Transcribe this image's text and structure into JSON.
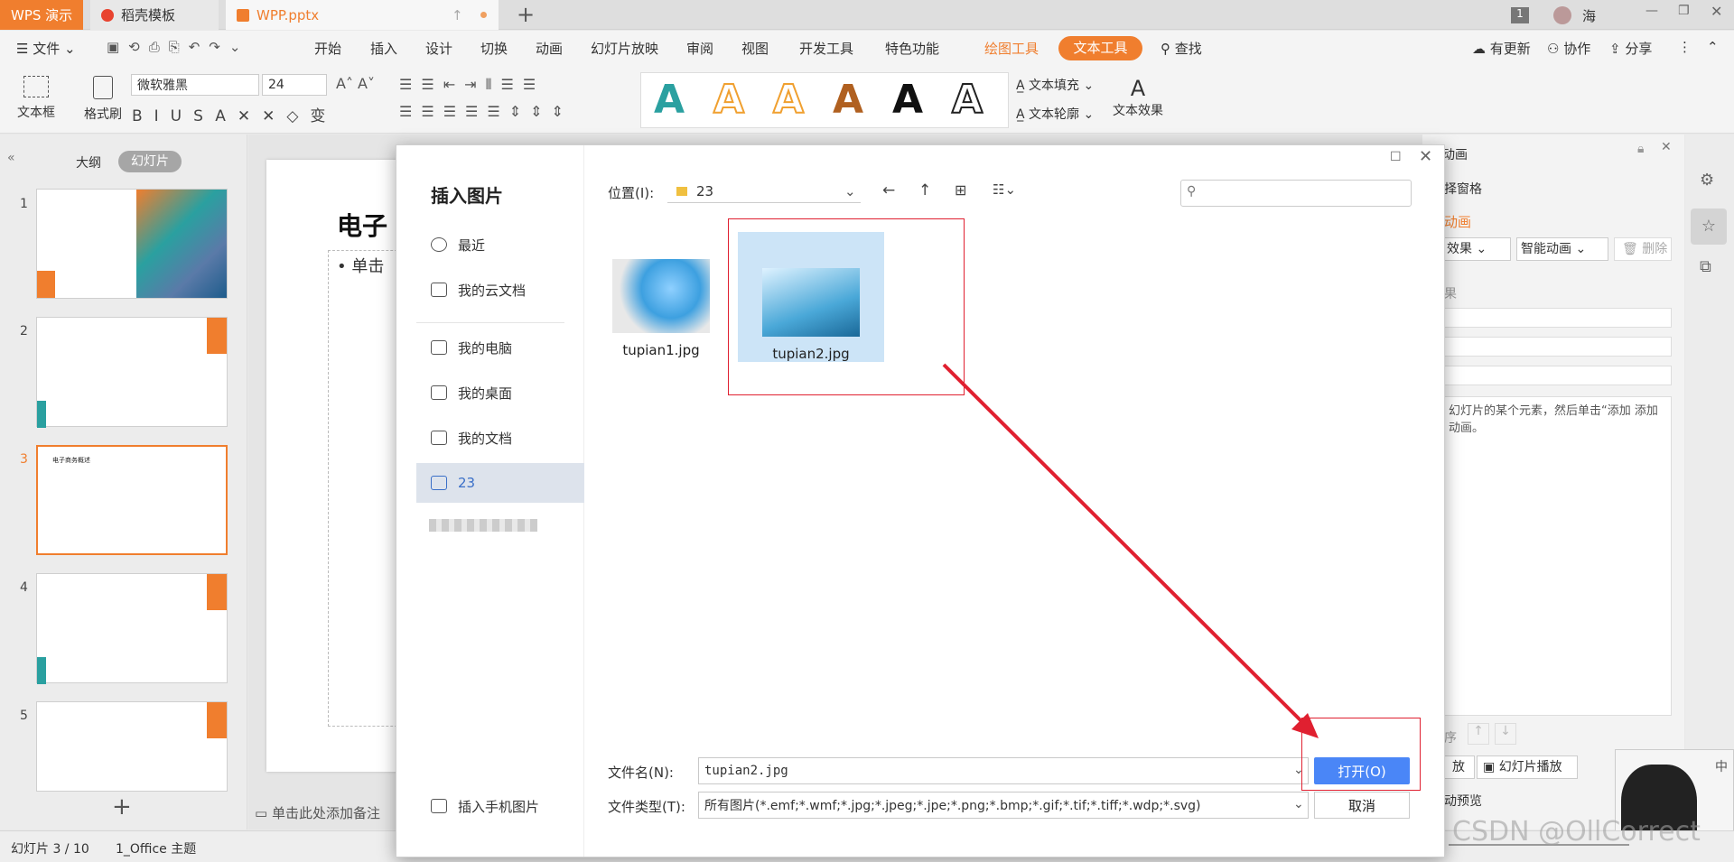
{
  "window": {
    "tabs": [
      "WPS 演示",
      "稻壳模板",
      "WPP.pptx"
    ],
    "user_badge": "1",
    "user_name": "海"
  },
  "menu": {
    "file": "文件",
    "items": [
      "开始",
      "插入",
      "设计",
      "切换",
      "动画",
      "幻灯片放映",
      "审阅",
      "视图",
      "开发工具",
      "特色功能"
    ],
    "drawing_tools": "绘图工具",
    "text_tools": "文本工具",
    "search": "查找",
    "update": "有更新",
    "collab": "协作",
    "share": "分享"
  },
  "ribbon": {
    "textbox": "文本框",
    "format_painter": "格式刷",
    "font": "微软雅黑",
    "size": "24",
    "text_fill": "文本填充",
    "text_outline": "文本轮廓",
    "text_effect": "文本效果",
    "style_glyph": "A"
  },
  "slides_panel": {
    "outline": "大纲",
    "slides": "幻灯片",
    "numbers": [
      "1",
      "2",
      "3",
      "4",
      "5"
    ],
    "thumb3_title": "电子商务概述"
  },
  "slide": {
    "title": "电子",
    "bullet": "• 单击",
    "notes": "单击此处添加备注"
  },
  "right_panel": {
    "title": "动画",
    "pane": "择窗格",
    "custom": "动画",
    "effect": "效果",
    "smart": "智能动画",
    "delete": "删除",
    "effect2": "果",
    "hint": "幻灯片的某个元素，然后单击“添加 添加动画。",
    "order": "序",
    "play": "放",
    "slideshow": "幻灯片播放",
    "preview": "动预览"
  },
  "status": {
    "slide": "幻灯片 3 / 10",
    "theme": "1_Office 主题",
    "zoom": "%"
  },
  "dialog": {
    "title": "插入图片",
    "nav": [
      {
        "label": "最近"
      },
      {
        "label": "我的云文档"
      },
      {
        "label": "我的电脑"
      },
      {
        "label": "我的桌面"
      },
      {
        "label": "我的文档"
      },
      {
        "label": "23"
      }
    ],
    "phone": "插入手机图片",
    "location_label": "位置(I):",
    "location": "23",
    "files": [
      "tupian1.jpg",
      "tupian2.jpg"
    ],
    "filename_label": "文件名(N):",
    "filename": "tupian2.jpg",
    "filetype_label": "文件类型(T):",
    "filetype": "所有图片(*.emf;*.wmf;*.jpg;*.jpeg;*.jpe;*.png;*.bmp;*.gif;*.tif;*.tiff;*.wdp;*.svg)",
    "open": "打开(O)",
    "cancel": "取消"
  },
  "watermark": "CSDN @OllCorrect",
  "colors": {
    "accent": "#f07e2e",
    "primary": "#4a86f7",
    "annotation": "#e02030"
  }
}
